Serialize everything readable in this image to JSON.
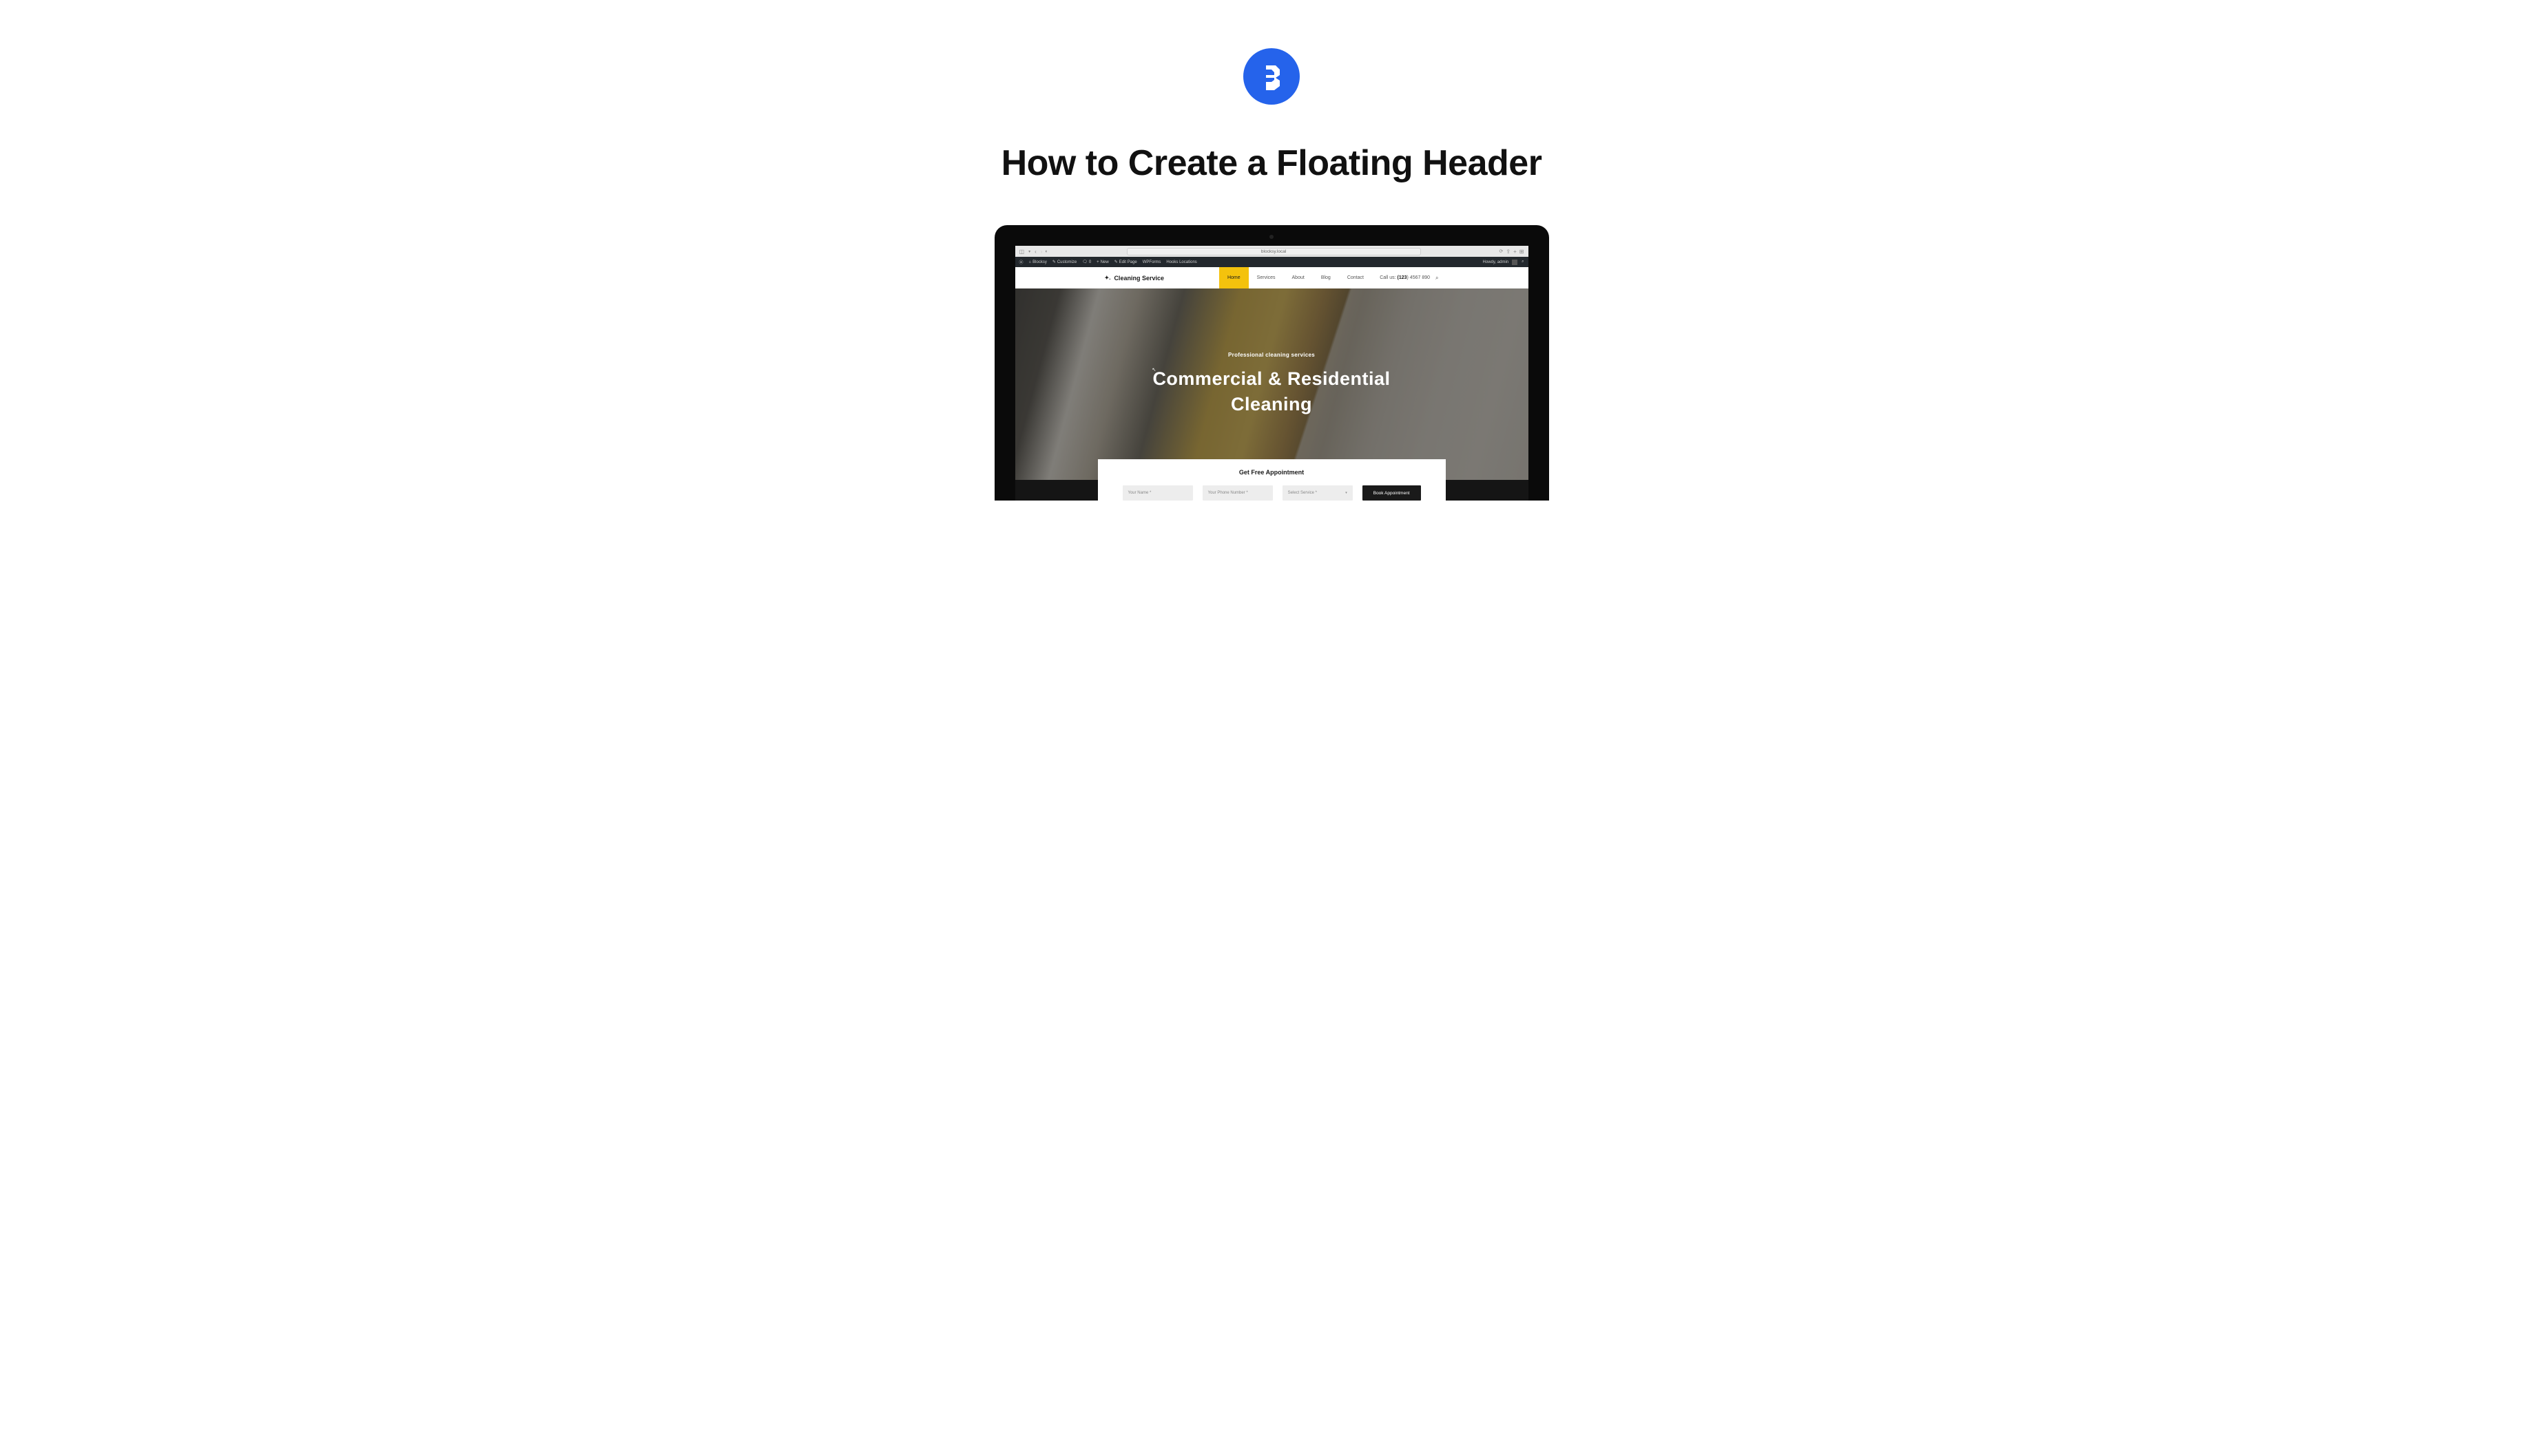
{
  "page": {
    "title": "How to Create a Floating Header"
  },
  "browser": {
    "url": "blocksy.local"
  },
  "wp_admin": {
    "site_name": "Blocksy",
    "customize": "Customize",
    "comments_count": "0",
    "new_label": "New",
    "edit_page": "Edit Page",
    "wpforms": "WPForms",
    "hooks": "Hooks Locations",
    "howdy": "Howdy, admin"
  },
  "site": {
    "name": "Cleaning Service",
    "nav": [
      {
        "label": "Home",
        "active": true
      },
      {
        "label": "Services",
        "active": false
      },
      {
        "label": "About",
        "active": false
      },
      {
        "label": "Blog",
        "active": false
      },
      {
        "label": "Contact",
        "active": false
      }
    ],
    "call_prefix": "Call us: ",
    "call_bold": "(123",
    "call_rest": ") 4567 890"
  },
  "hero": {
    "subtitle": "Professional cleaning services",
    "title_line1": "Commercial & Residential",
    "title_line2": "Cleaning"
  },
  "appointment": {
    "title": "Get Free Appointment",
    "name_placeholder": "Your Name *",
    "phone_placeholder": "Your Phone Number *",
    "service_placeholder": "Select Service *",
    "button": "Book Appointment"
  }
}
